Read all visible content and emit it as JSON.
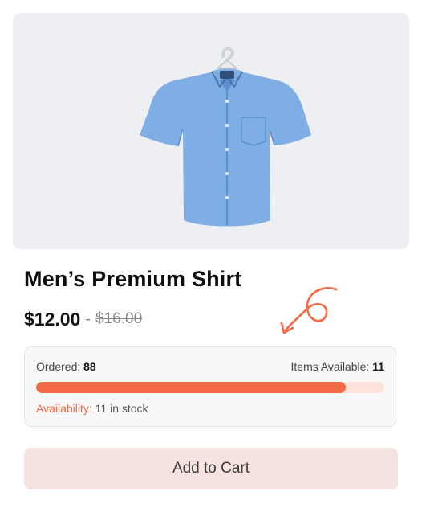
{
  "product": {
    "title": "Men’s Premium Shirt",
    "price": "$12.00",
    "separator": "-",
    "old_price": "$16.00",
    "image_icon": "blue-shirt-on-hanger"
  },
  "stock": {
    "ordered_label": "Ordered:",
    "ordered_value": "88",
    "available_label": "Items Available:",
    "available_value": "11",
    "progress_fraction": 0.89,
    "availability_label": "Availability:",
    "availability_value": "11 in stock"
  },
  "actions": {
    "add_to_cart": "Add to Cart"
  },
  "colors": {
    "accent": "#f26a45",
    "bar_track": "#fde3dc",
    "button_bg": "#f6e2de",
    "image_bg": "#edeff3"
  }
}
